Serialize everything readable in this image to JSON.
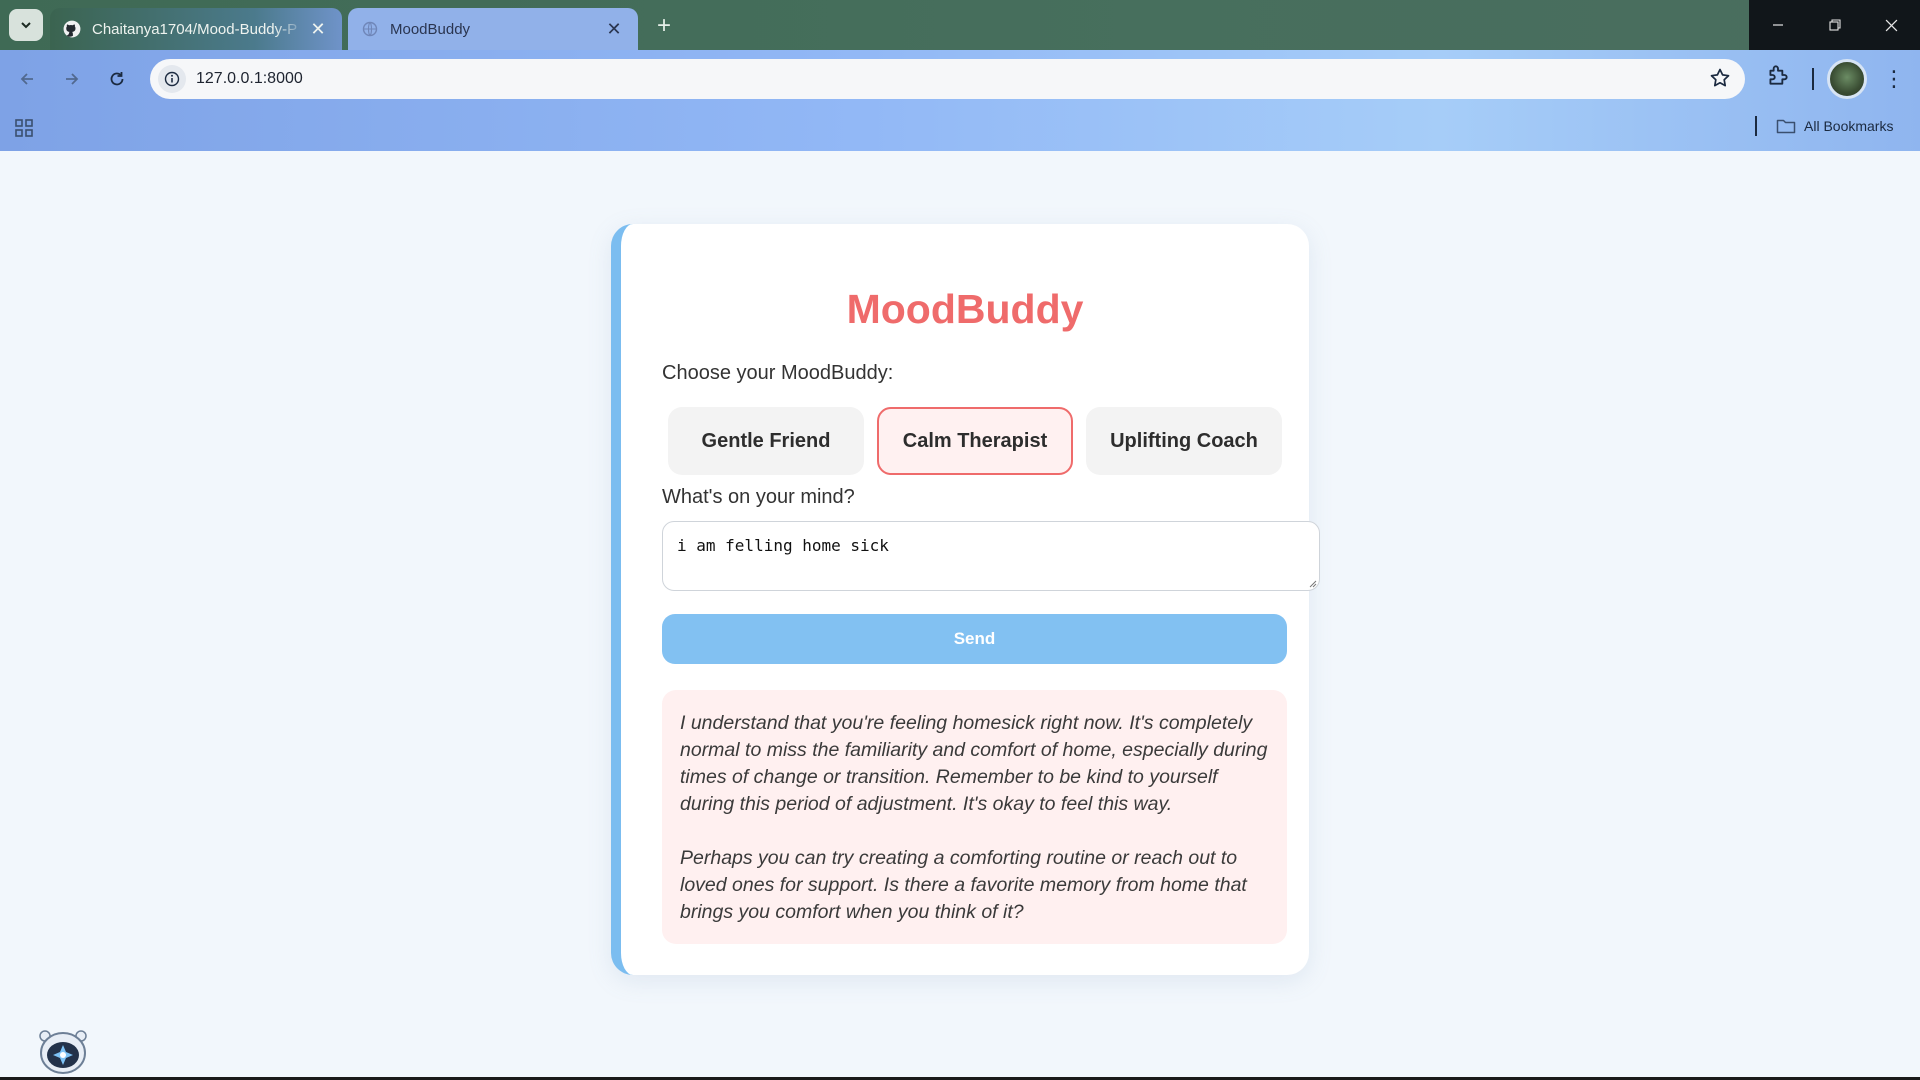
{
  "browser": {
    "tabs": [
      {
        "title": "Chaitanya1704/Mood-Buddy-P",
        "icon": "github-icon"
      },
      {
        "title": "MoodBuddy",
        "icon": "globe-icon"
      }
    ],
    "url": "127.0.0.1:8000",
    "bookmarks_label": "All Bookmarks"
  },
  "app": {
    "title": "MoodBuddy",
    "choose_label": "Choose your MoodBuddy:",
    "modes": [
      {
        "label": "Gentle Friend",
        "selected": false
      },
      {
        "label": "Calm Therapist",
        "selected": true
      },
      {
        "label": "Uplifting Coach",
        "selected": false
      }
    ],
    "mind_label": "What's on your mind?",
    "input_value": "i am felling home sick",
    "send_label": "Send",
    "response": {
      "p1": "I understand that you're feeling homesick right now. It's completely normal to miss the familiarity and comfort of home, especially during times of change or transition. Remember to be kind to yourself during this period of adjustment. It's okay to feel this way.",
      "p2": "Perhaps you can try creating a comforting routine or reach out to loved ones for support. Is there a favorite memory from home that brings you comfort when you think of it?"
    }
  },
  "colors": {
    "accent": "#ef6b6b",
    "send": "#82c1f2",
    "card_border": "#7bbdf0",
    "response_bg": "#fff0f0"
  }
}
